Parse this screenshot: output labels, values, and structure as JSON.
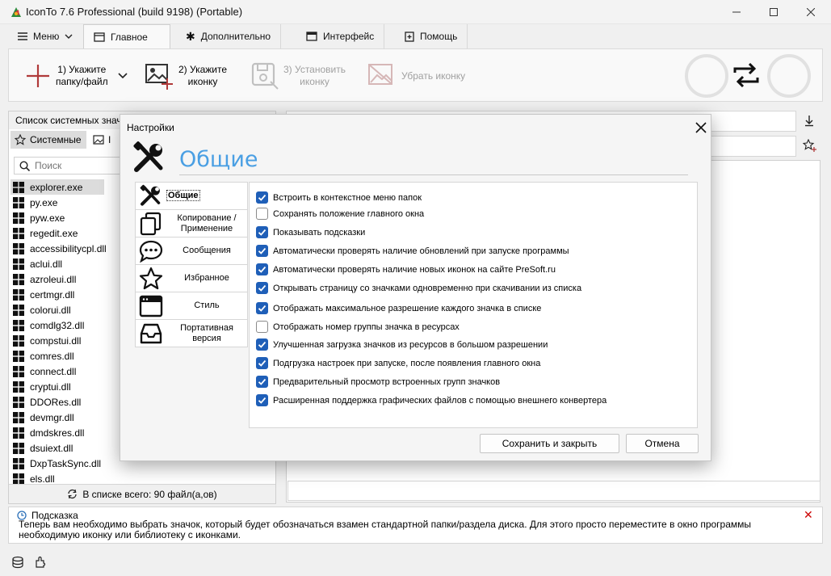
{
  "window": {
    "title": "IconTo 7.6 Professional (build 9198) (Portable)",
    "minimize_icon": "minimize-icon",
    "maximize_icon": "maximize-icon",
    "close_icon": "close-icon"
  },
  "tabs": [
    {
      "label": "Меню",
      "icon": "hamburger-icon"
    },
    {
      "label": "Главное",
      "icon": "home-icon"
    },
    {
      "label": "Дополнительно",
      "icon": "asterisk-icon"
    },
    {
      "label": "Интерфейс",
      "icon": "window-icon"
    },
    {
      "label": "Помощь",
      "icon": "help-icon"
    }
  ],
  "ribbon": {
    "step1_label": "1) Укажите\nпапку/файл",
    "step2_label": "2) Укажите\nиконку",
    "step3_label": "3) Установить\nиконку",
    "remove_label": "Убрать иконку"
  },
  "left_panel": {
    "header": "Список системных значков",
    "tab_system": "Системные",
    "search_placeholder": "Поиск",
    "files": [
      "explorer.exe",
      "py.exe",
      "pyw.exe",
      "regedit.exe",
      "accessibilitycpl.dll",
      "aclui.dll",
      "azroleui.dll",
      "certmgr.dll",
      "colorui.dll",
      "comdlg32.dll",
      "compstui.dll",
      "comres.dll",
      "connect.dll",
      "cryptui.dll",
      "DDORes.dll",
      "devmgr.dll",
      "dmdskres.dll",
      "dsuiext.dll",
      "DxpTaskSync.dll",
      "els.dll"
    ],
    "footer": "В списке всего: 90 файл(а,ов)"
  },
  "hint": {
    "title": "Подсказка",
    "text": "Теперь вам необходимо выбрать значок, который будет обозначаться взамен стандартной папки/раздела диска. Для этого просто переместите в окно программы необходимую иконку или библиотеку с иконками."
  },
  "dialog": {
    "title": "Настройки",
    "heading": "Общие",
    "nav": [
      {
        "label": "Общие",
        "icon": "tools-icon"
      },
      {
        "label": "Копирование /\nПрименение",
        "icon": "copy-icon"
      },
      {
        "label": "Сообщения",
        "icon": "chat-icon"
      },
      {
        "label": "Избранное",
        "icon": "star-icon"
      },
      {
        "label": "Стиль",
        "icon": "window-style-icon"
      },
      {
        "label": "Портативная\nверсия",
        "icon": "inbox-icon"
      }
    ],
    "options": [
      {
        "label": "Встроить в контекстное меню папок",
        "checked": true
      },
      {
        "label": "Сохранять положение главного окна",
        "checked": false
      },
      {
        "label": "Показывать подсказки",
        "checked": true
      },
      {
        "label": "Автоматически проверять наличие обновлений при запуске программы",
        "checked": true
      },
      {
        "label": "Автоматически проверять наличие новых иконок на сайте PreSoft.ru",
        "checked": true
      },
      {
        "label": "Открывать страницу со значками одновременно при скачивании из списка",
        "checked": true
      },
      {
        "label": "Отображать максимальное разрешение каждого значка в списке",
        "checked": true
      },
      {
        "label": "Отображать номер группы значка в ресурсах",
        "checked": false
      },
      {
        "label": "Улучшенная загрузка значков из ресурсов в большом разрешении",
        "checked": true
      },
      {
        "label": "Подгрузка настроек при запуске, после появления главного окна",
        "checked": true
      },
      {
        "label": "Предварительный просмотр встроенных групп значков",
        "checked": true
      },
      {
        "label": "Расширенная поддержка графических файлов с помощью внешнего конвертера",
        "checked": true
      }
    ],
    "save_label": "Сохранить и закрыть",
    "cancel_label": "Отмена"
  },
  "colors": {
    "accent_heading": "#4a9fe3",
    "checkbox_on": "#1f5fb8",
    "hint_close": "#cc0000"
  }
}
